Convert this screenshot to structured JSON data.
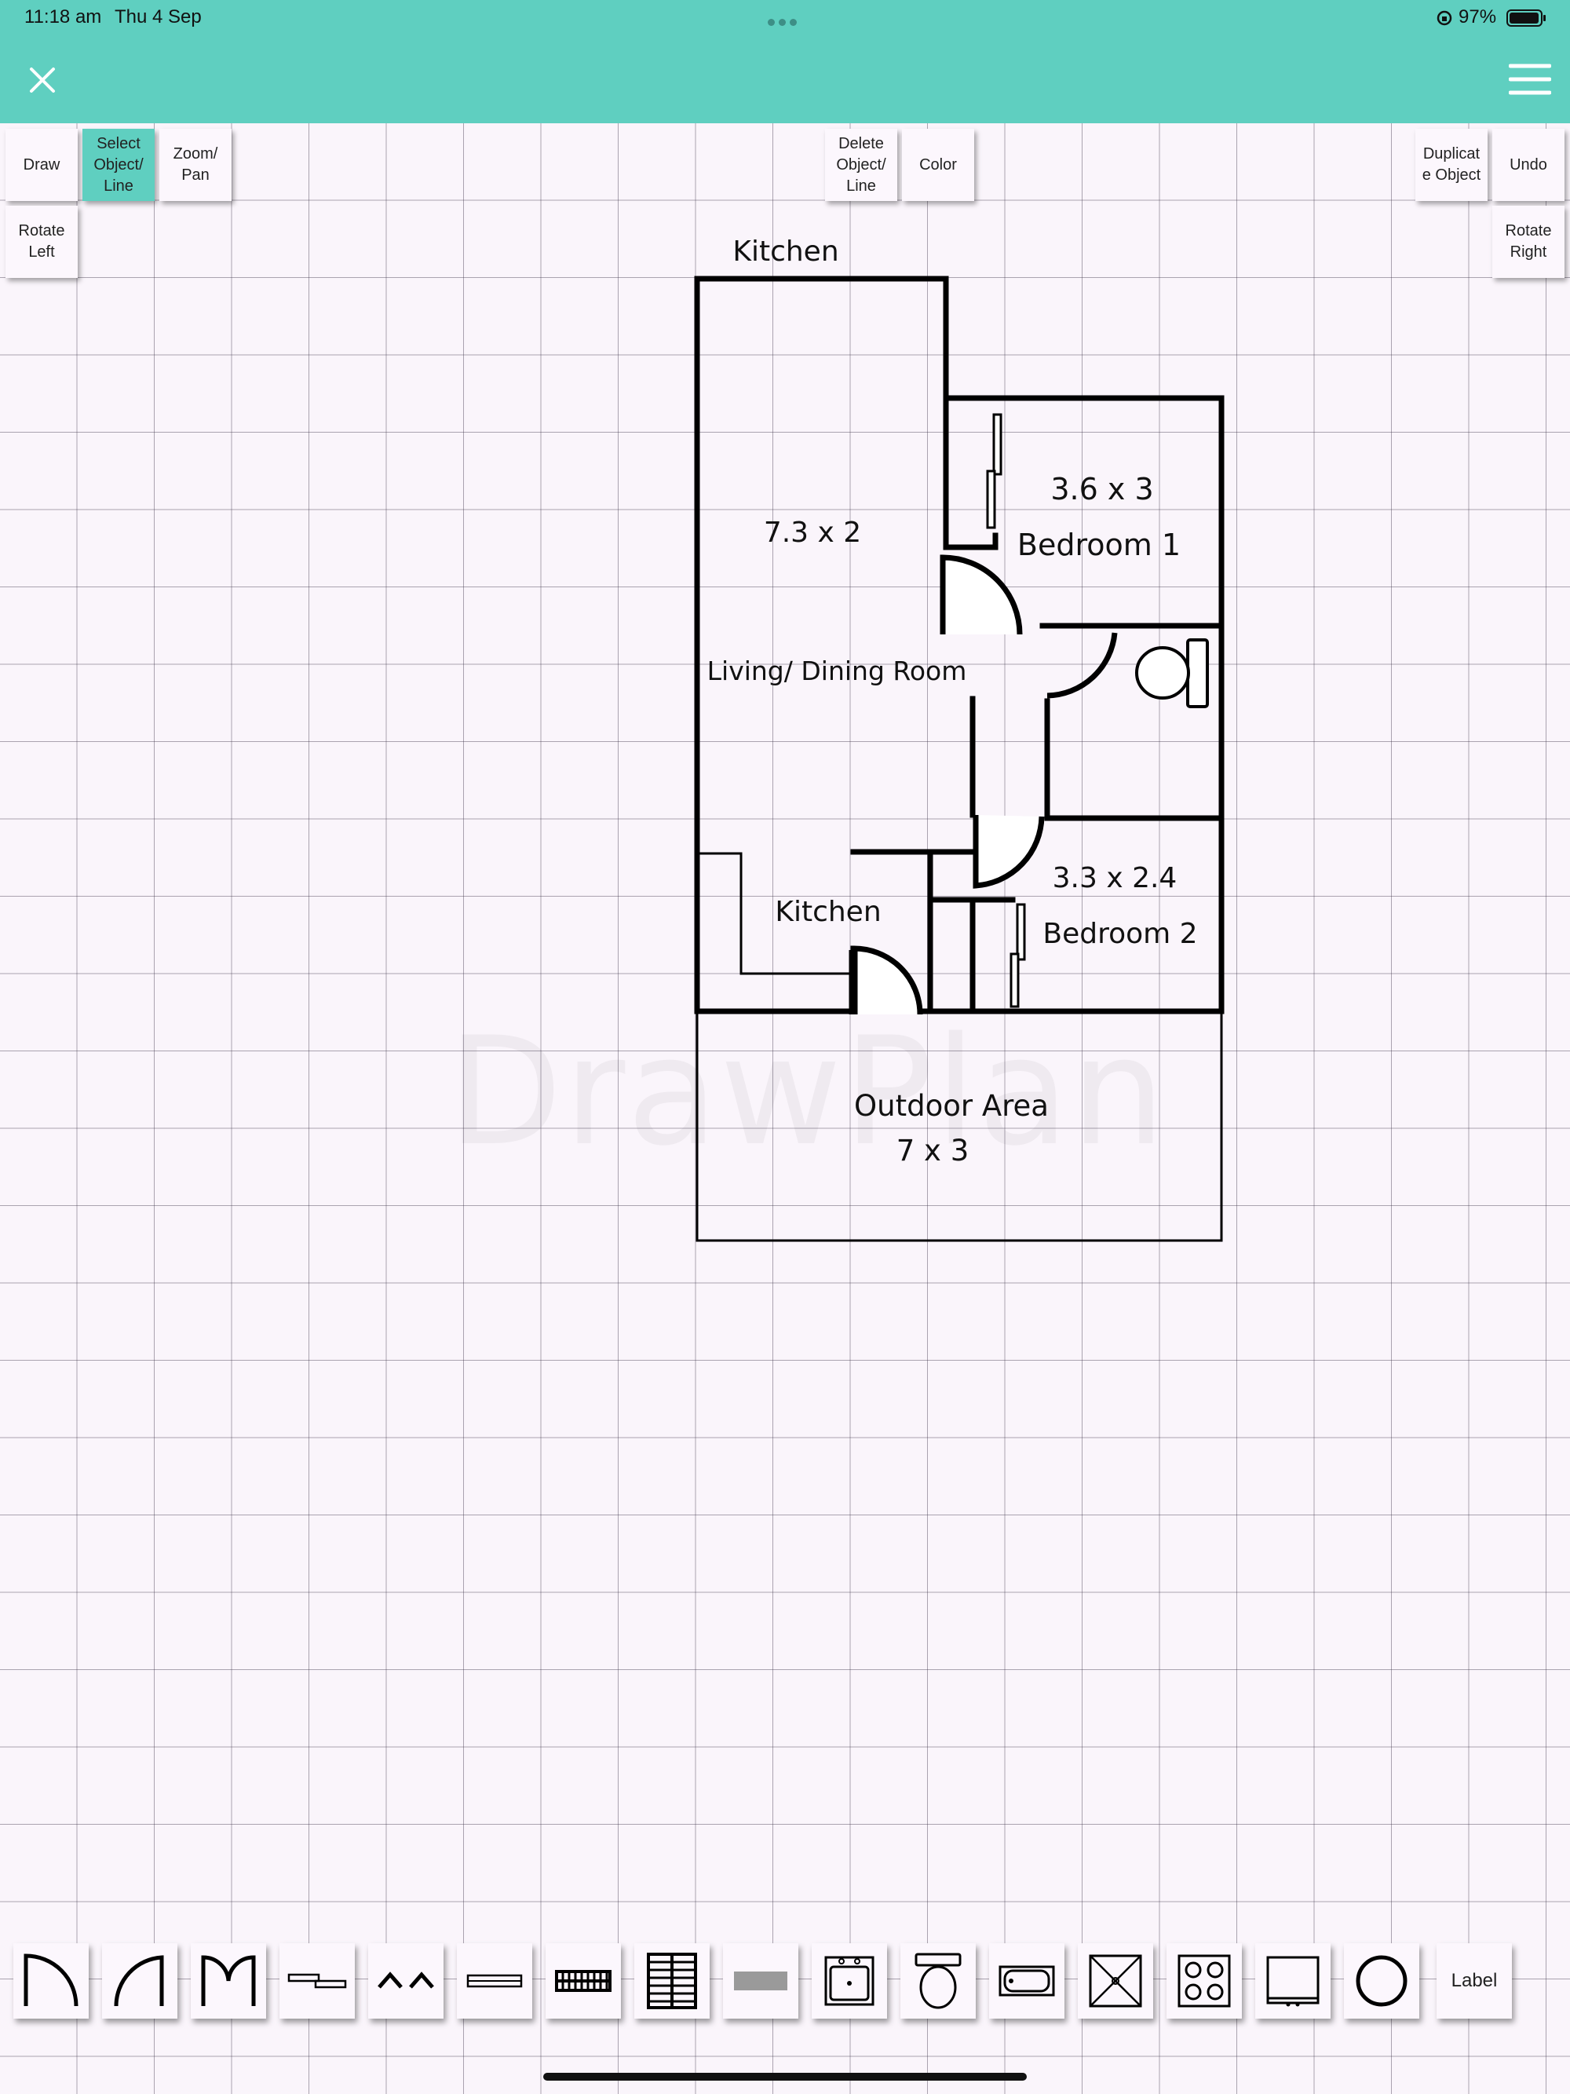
{
  "status_bar": {
    "time": "11:18 am",
    "date": "Thu 4 Sep",
    "battery": "97%"
  },
  "colors": {
    "accent": "#5fcfc0",
    "canvas": "#faf5fb",
    "ink": "#000000"
  },
  "toolbar": {
    "draw": "Draw",
    "select": "Select\nObject/\nLine",
    "zoom": "Zoom/\nPan",
    "delete": "Delete\nObject/\nLine",
    "color": "Color",
    "duplicate": "Duplicat\ne Object",
    "undo": "Undo",
    "rotate_left": "Rotate\nLeft",
    "rotate_right": "Rotate\nRight",
    "active": "select"
  },
  "floor_plan": {
    "kitchen_top": "Kitchen",
    "living_dims": "7.3 x 2",
    "living_name": "Living/ Dining Room",
    "bedroom1_dims": "3.6 x 3",
    "bedroom1_name": "Bedroom 1",
    "bedroom2_dims": "3.3 x 2.4",
    "bedroom2_name": "Bedroom 2",
    "kitchen_inner": "Kitchen",
    "outdoor_name": "Outdoor Area",
    "outdoor_dims": "7 x 3"
  },
  "watermark": "DrawPlan",
  "palette": {
    "items": [
      "door-icon",
      "single-door-icon",
      "double-door-icon",
      "sliding-door-icon",
      "bifold-door-icon",
      "window-icon",
      "stairs-icon",
      "stairs-landing-icon",
      "wall-block-icon",
      "sink-icon",
      "toilet-icon",
      "bath-icon",
      "shower-icon",
      "cooktop-icon",
      "cabinet-icon",
      "circle-icon"
    ],
    "label_button": "Label"
  }
}
